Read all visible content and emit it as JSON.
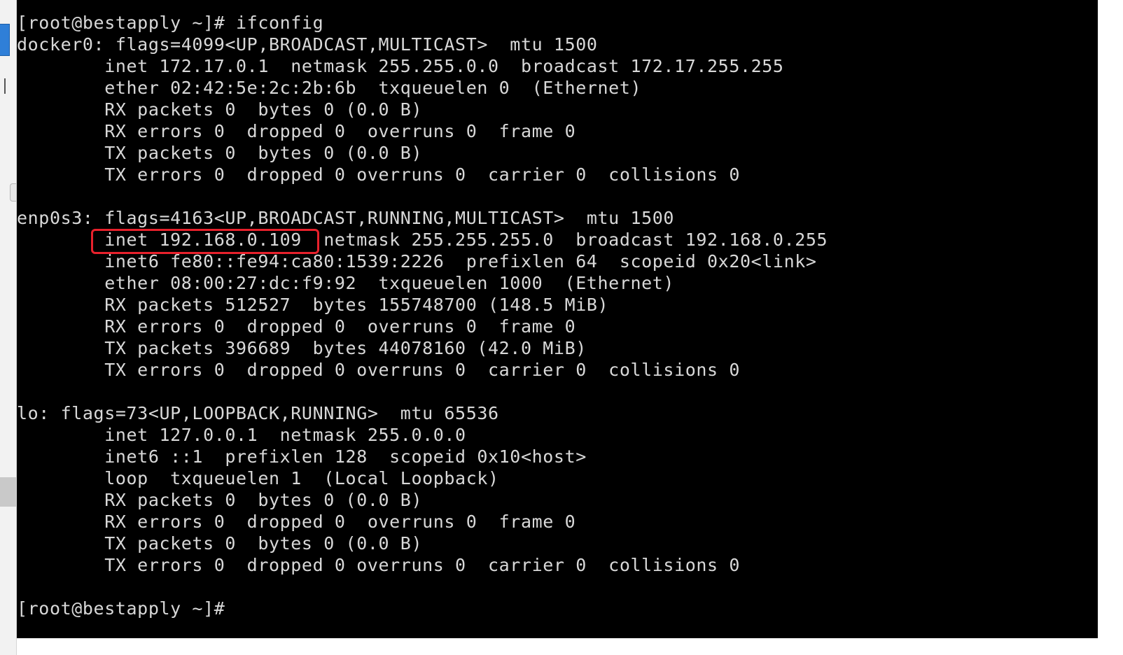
{
  "terminal": {
    "lines": [
      "[root@bestapply ~]# ifconfig",
      "docker0: flags=4099<UP,BROADCAST,MULTICAST>  mtu 1500",
      "        inet 172.17.0.1  netmask 255.255.0.0  broadcast 172.17.255.255",
      "        ether 02:42:5e:2c:2b:6b  txqueuelen 0  (Ethernet)",
      "        RX packets 0  bytes 0 (0.0 B)",
      "        RX errors 0  dropped 0  overruns 0  frame 0",
      "        TX packets 0  bytes 0 (0.0 B)",
      "        TX errors 0  dropped 0 overruns 0  carrier 0  collisions 0",
      "",
      "enp0s3: flags=4163<UP,BROADCAST,RUNNING,MULTICAST>  mtu 1500",
      "        inet 192.168.0.109  netmask 255.255.255.0  broadcast 192.168.0.255",
      "        inet6 fe80::fe94:ca80:1539:2226  prefixlen 64  scopeid 0x20<link>",
      "        ether 08:00:27:dc:f9:92  txqueuelen 1000  (Ethernet)",
      "        RX packets 512527  bytes 155748700 (148.5 MiB)",
      "        RX errors 0  dropped 0  overruns 0  frame 0",
      "        TX packets 396689  bytes 44078160 (42.0 MiB)",
      "        TX errors 0  dropped 0 overruns 0  carrier 0  collisions 0",
      "",
      "lo: flags=73<UP,LOOPBACK,RUNNING>  mtu 65536",
      "        inet 127.0.0.1  netmask 255.0.0.0",
      "        inet6 ::1  prefixlen 128  scopeid 0x10<host>",
      "        loop  txqueuelen 1  (Local Loopback)",
      "        RX packets 0  bytes 0 (0.0 B)",
      "        RX errors 0  dropped 0  overruns 0  frame 0",
      "        TX packets 0  bytes 0 (0.0 B)",
      "        TX errors 0  dropped 0 overruns 0  carrier 0  collisions 0",
      "",
      "[root@bestapply ~]#"
    ]
  },
  "colors": {
    "terminal_background": "#000000",
    "terminal_text": "#d8d8d8",
    "highlight_border": "#e8212c",
    "sidebar_accent": "#2f7fd8"
  }
}
